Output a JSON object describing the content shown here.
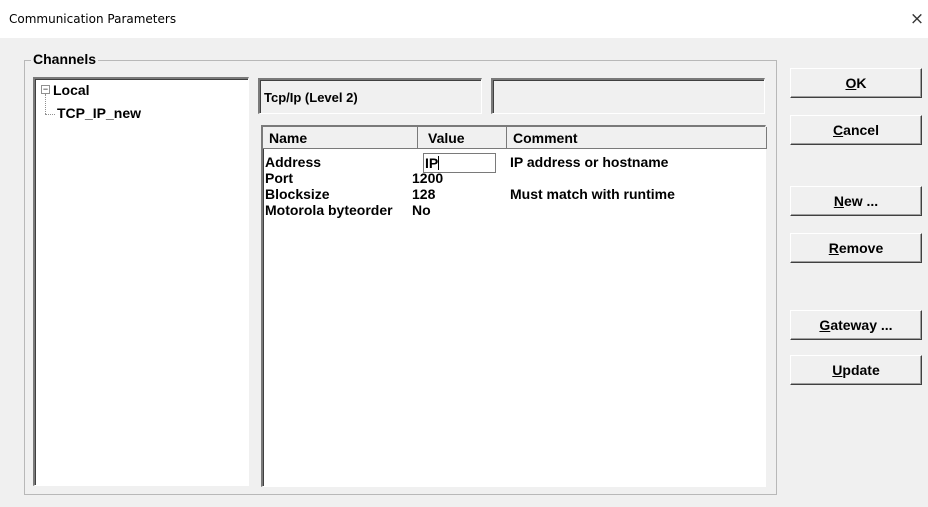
{
  "window": {
    "title": "Communication Parameters",
    "close_glyph": "×"
  },
  "channels": {
    "legend": "Channels",
    "tree": [
      {
        "label": "Local",
        "expander": "⊟"
      },
      {
        "label": "TCP_IP_new"
      }
    ]
  },
  "driver_field": "Tcp/Ip (Level 2)",
  "info_field": "",
  "table": {
    "headers": [
      "Name",
      "Value",
      "Comment"
    ],
    "rows": [
      {
        "name": "Address",
        "value": "IP",
        "comment": "IP address or hostname"
      },
      {
        "name": "Port",
        "value": "1200",
        "comment": ""
      },
      {
        "name": "Blocksize",
        "value": "128",
        "comment": "Must match with runtime"
      },
      {
        "name": "Motorola byteorder",
        "value": "No",
        "comment": ""
      }
    ]
  },
  "buttons": {
    "ok": {
      "mnemonic": "O",
      "rest": "K"
    },
    "cancel": {
      "mnemonic": "C",
      "rest": "ancel"
    },
    "new": {
      "mnemonic": "N",
      "rest": "ew ..."
    },
    "remove": {
      "mnemonic": "R",
      "rest": "emove"
    },
    "gateway": {
      "mnemonic": "G",
      "rest": "ateway ..."
    },
    "update": {
      "mnemonic": "U",
      "rest": "pdate"
    }
  }
}
